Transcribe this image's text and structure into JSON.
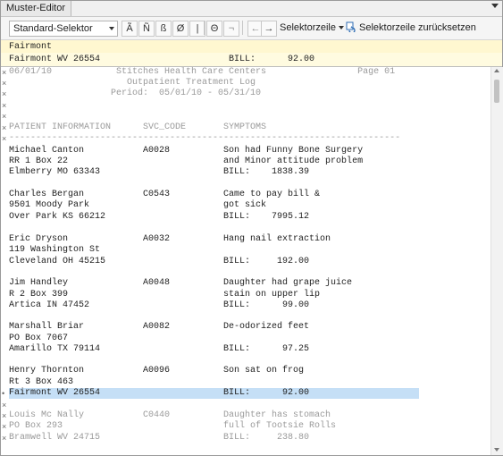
{
  "window": {
    "title": "Muster-Editor"
  },
  "toolbar": {
    "selector_value": "Standard-Selektor",
    "char_buttons": [
      "Ã",
      "Ñ",
      "ß",
      "Ø",
      "|",
      "Θ",
      "¬"
    ],
    "nav_left": "←",
    "nav_right": "→",
    "selector_row_label": "Selektorzeile",
    "reset_label": "Selektorzeile zurücksetzen"
  },
  "input_row": {
    "value": "Fairmont"
  },
  "preview_row": {
    "value": "Fairmont WV 26554                        BILL:      92.00"
  },
  "editor": {
    "lines": [
      {
        "marker": "×",
        "text": "06/01/10            Stitches Health Care Centers                 Page 01",
        "style": "gray"
      },
      {
        "marker": "×",
        "text": "                      Outpatient Treatment Log",
        "style": "gray"
      },
      {
        "marker": "×",
        "text": "                   Period:  05/01/10 - 05/31/10",
        "style": "gray"
      },
      {
        "marker": "×",
        "text": "",
        "style": "gray"
      },
      {
        "marker": "×",
        "text": "",
        "style": "gray"
      },
      {
        "marker": "×",
        "text": "PATIENT INFORMATION      SVC_CODE       SYMPTOMS",
        "style": "gray"
      },
      {
        "marker": "×",
        "text": "-------------------------------------------------------------------------",
        "style": "gray"
      },
      {
        "marker": "",
        "text": "",
        "style": "normal"
      },
      {
        "marker": "",
        "text": "Michael Canton           A0028          Son had Funny Bone Surgery",
        "style": "normal"
      },
      {
        "marker": "",
        "text": "RR 1 Box 22                             and Minor attitude problem",
        "style": "normal"
      },
      {
        "marker": "",
        "text": "Elmberry MO 63343                       BILL:    1838.39",
        "style": "normal"
      },
      {
        "marker": "",
        "text": "",
        "style": "normal"
      },
      {
        "marker": "",
        "text": "Charles Bergan           C0543          Came to pay bill &",
        "style": "normal"
      },
      {
        "marker": "",
        "text": "9501 Moody Park                         got sick",
        "style": "normal"
      },
      {
        "marker": "",
        "text": "Over Park KS 66212                      BILL:    7995.12",
        "style": "normal"
      },
      {
        "marker": "",
        "text": "",
        "style": "normal"
      },
      {
        "marker": "",
        "text": "Eric Dryson              A0032          Hang nail extraction",
        "style": "normal"
      },
      {
        "marker": "",
        "text": "119 Washington St",
        "style": "normal"
      },
      {
        "marker": "",
        "text": "Cleveland OH 45215                      BILL:     192.00",
        "style": "normal"
      },
      {
        "marker": "",
        "text": "",
        "style": "normal"
      },
      {
        "marker": "",
        "text": "Jim Handley              A0048          Daughter had grape juice",
        "style": "normal"
      },
      {
        "marker": "",
        "text": "R 2 Box 399                             stain on upper lip",
        "style": "normal"
      },
      {
        "marker": "",
        "text": "Artica IN 47452                         BILL:      99.00",
        "style": "normal"
      },
      {
        "marker": "",
        "text": "",
        "style": "normal"
      },
      {
        "marker": "",
        "text": "Marshall Briar           A0082          De-odorized feet",
        "style": "normal"
      },
      {
        "marker": "",
        "text": "PO Box 7067",
        "style": "normal"
      },
      {
        "marker": "",
        "text": "Amarillo TX 79114                       BILL:      97.25",
        "style": "normal"
      },
      {
        "marker": "",
        "text": "",
        "style": "normal"
      },
      {
        "marker": "",
        "text": "Henry Thornton           A0096          Son sat on frog",
        "style": "normal"
      },
      {
        "marker": "",
        "text": "Rt 3 Box 463",
        "style": "normal"
      },
      {
        "marker": "•",
        "text": "Fairmont WV 26554                       BILL:      92.00",
        "style": "hl"
      },
      {
        "marker": "×",
        "text": "",
        "style": "gray"
      },
      {
        "marker": "×",
        "text": "Louis Mc Nally           C0440          Daughter has stomach",
        "style": "gray"
      },
      {
        "marker": "×",
        "text": "PO Box 293                              full of Tootsie Rolls",
        "style": "gray"
      },
      {
        "marker": "×",
        "text": "Bramwell WV 24715                       BILL:     238.80",
        "style": "gray"
      }
    ]
  }
}
